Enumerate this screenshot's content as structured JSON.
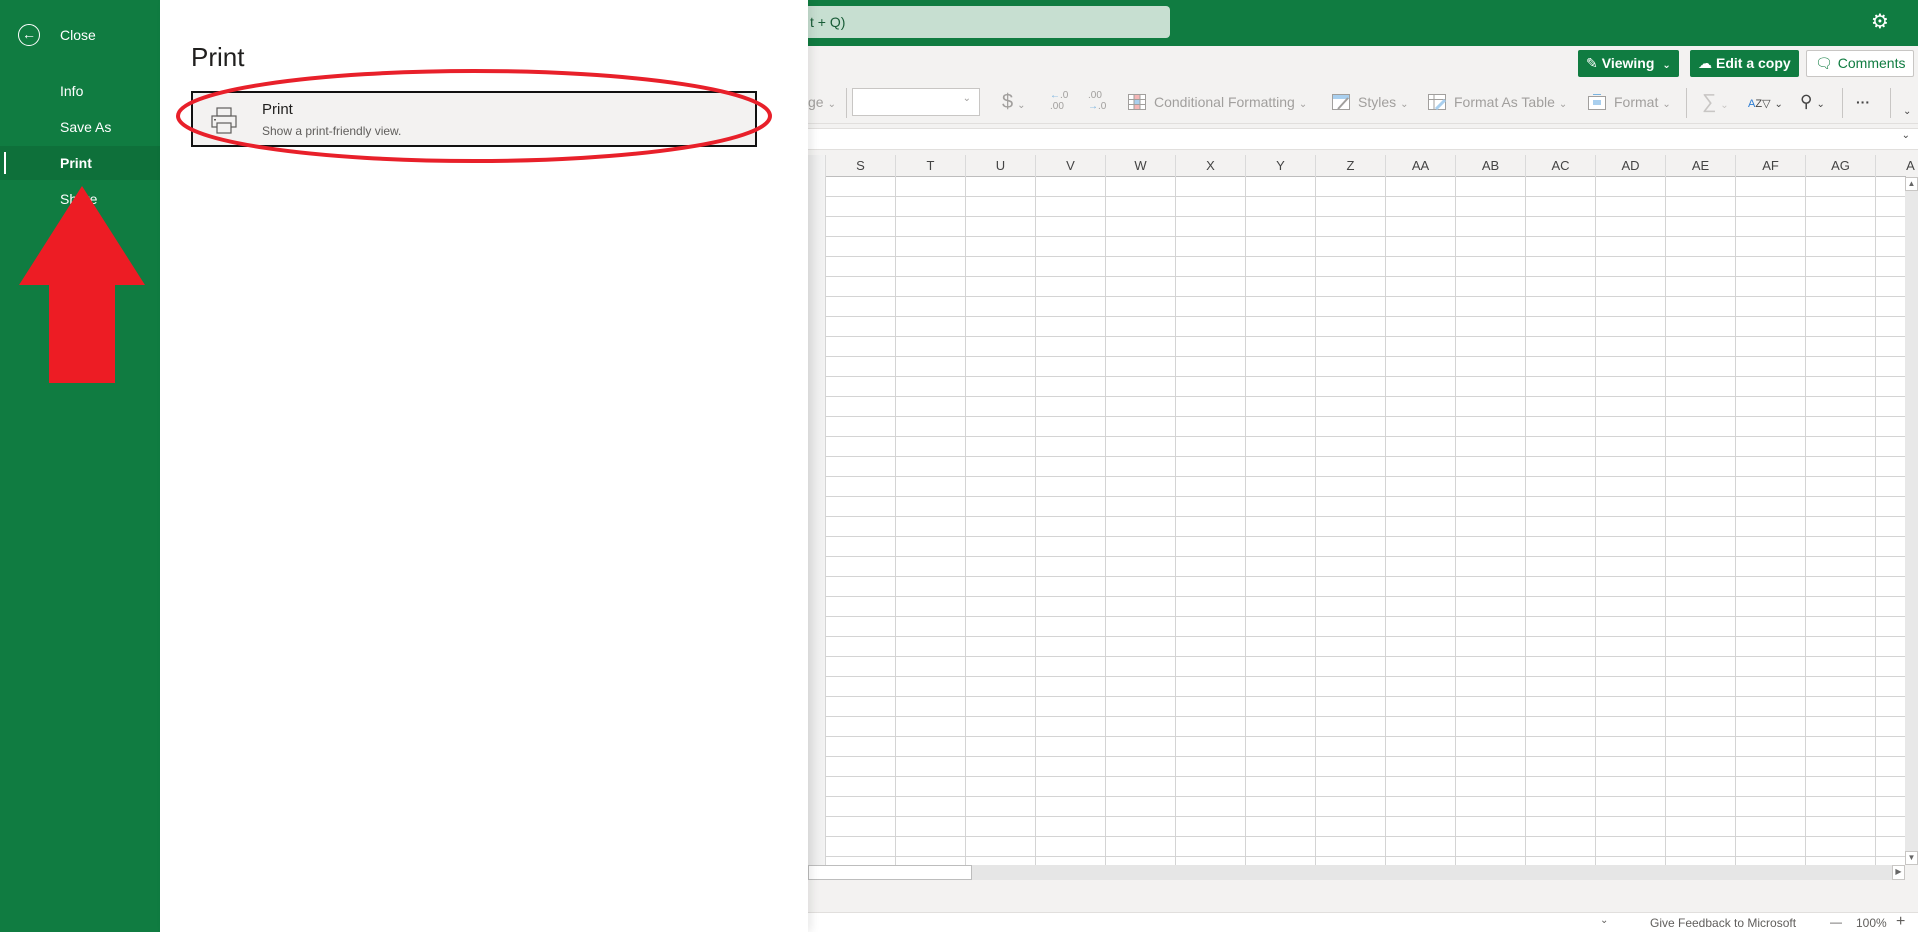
{
  "header": {
    "search_text": "t + Q)",
    "settings_icon": "gear-icon"
  },
  "ribbon": {
    "viewing_label": "Viewing",
    "edit_copy_label": "Edit a copy",
    "comments_label": "Comments",
    "tools": {
      "merge_partial": "ge",
      "currency_symbol": "$",
      "increase_decimal": "←.0 .00",
      "decrease_decimal": ".00 →.0",
      "conditional_formatting": "Conditional Formatting",
      "styles": "Styles",
      "format_as_table": "Format As Table",
      "format": "Format",
      "more": "···"
    }
  },
  "sheet": {
    "columns": [
      "S",
      "T",
      "U",
      "V",
      "W",
      "X",
      "Y",
      "Z",
      "AA",
      "AB",
      "AC",
      "AD",
      "AE",
      "AF",
      "AG",
      "A"
    ]
  },
  "status_bar": {
    "feedback": "Give Feedback to Microsoft",
    "zoom_level": "100%",
    "zoom_out": "—",
    "zoom_in": "+"
  },
  "sidebar": {
    "close_label": "Close",
    "items": [
      {
        "label": "Info",
        "active": false
      },
      {
        "label": "Save As",
        "active": false
      },
      {
        "label": "Print",
        "active": true
      },
      {
        "label": "Share",
        "active": false
      }
    ]
  },
  "backstage": {
    "title": "Print",
    "card": {
      "title": "Print",
      "description": "Show a print-friendly view."
    }
  },
  "annotations": {
    "ellipse_color": "#e8202a",
    "arrow_color": "#ed1c24"
  },
  "colors": {
    "brand_green": "#107c41",
    "sidebar_active": "#0e703a",
    "search_bg": "#c7dfd1"
  }
}
